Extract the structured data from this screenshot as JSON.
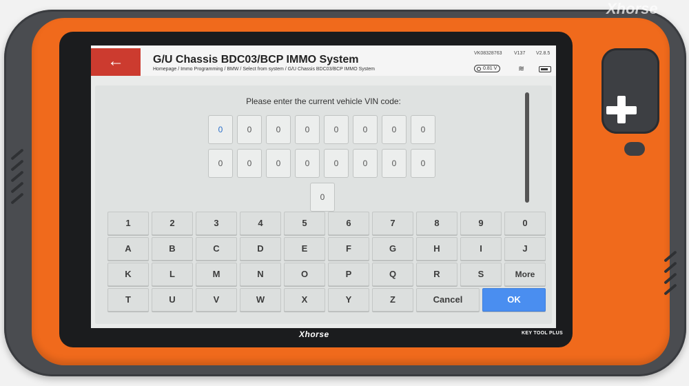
{
  "header": {
    "back_icon": "arrow-left",
    "title": "G/U Chassis BDC03/BCP IMMO System",
    "breadcrumb": "Homepage / Immo Programming / BMW / Select from  system / G/U Chassis BDC03/BCP IMMO System",
    "device_id": "VK08328763",
    "firmware": "V137",
    "app_version": "V2.8.5",
    "voltage": "0.81 V"
  },
  "prompt": "Please enter the current vehicle VIN code:",
  "vin": {
    "row1": [
      "0",
      "0",
      "0",
      "0",
      "0",
      "0",
      "0",
      "0"
    ],
    "row2": [
      "0",
      "0",
      "0",
      "0",
      "0",
      "0",
      "0",
      "0"
    ],
    "row3": [
      "0"
    ]
  },
  "keyboard": {
    "row1": [
      "1",
      "2",
      "3",
      "4",
      "5",
      "6",
      "7",
      "8",
      "9",
      "0"
    ],
    "row2": [
      "A",
      "B",
      "C",
      "D",
      "E",
      "F",
      "G",
      "H",
      "I",
      "J"
    ],
    "row3": [
      "K",
      "L",
      "M",
      "N",
      "O",
      "P",
      "Q",
      "R",
      "S",
      "More"
    ],
    "row4": [
      "T",
      "U",
      "V",
      "W",
      "X",
      "Y",
      "Z"
    ],
    "cancel": "Cancel",
    "ok": "OK"
  },
  "device": {
    "brand": "Xhorse",
    "model": "KEY TOOL PLUS",
    "watermark": "Xhorse"
  },
  "colors": {
    "orange": "#f06a1c",
    "back_button": "#cc3b2f",
    "ok_button": "#4a8ef0"
  }
}
